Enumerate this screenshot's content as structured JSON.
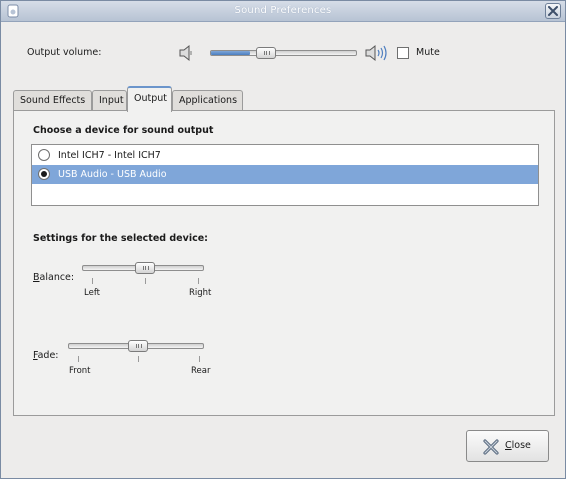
{
  "window": {
    "title": "Sound Preferences"
  },
  "volume": {
    "label": "Output volume:",
    "level": 0.27,
    "mute_label": "Mute",
    "mute_checked": false
  },
  "tabs": [
    {
      "label": "Sound Effects",
      "active": false
    },
    {
      "label": "Input",
      "active": false
    },
    {
      "label": "Output",
      "active": true
    },
    {
      "label": "Applications",
      "active": false
    }
  ],
  "output": {
    "heading": "Choose a device for sound output",
    "devices": [
      {
        "label": "Intel ICH7 - Intel ICH7",
        "selected": false
      },
      {
        "label": "USB Audio - USB Audio",
        "selected": true
      }
    ],
    "settings_heading": "Settings for the selected device:",
    "balance": {
      "mnemonic": "B",
      "rest": "alance:",
      "left": "Left",
      "right": "Right",
      "value": 0.5
    },
    "fade": {
      "mnemonic": "F",
      "rest": "ade:",
      "front": "Front",
      "rear": "Rear",
      "value": 0.5
    }
  },
  "close_button": {
    "mnemonic": "C",
    "rest": "lose"
  },
  "icons": {
    "title_close": "close-icon",
    "speaker_low": "speaker-low-icon",
    "speaker_high": "speaker-high-icon",
    "close_button": "close-x-icon"
  }
}
